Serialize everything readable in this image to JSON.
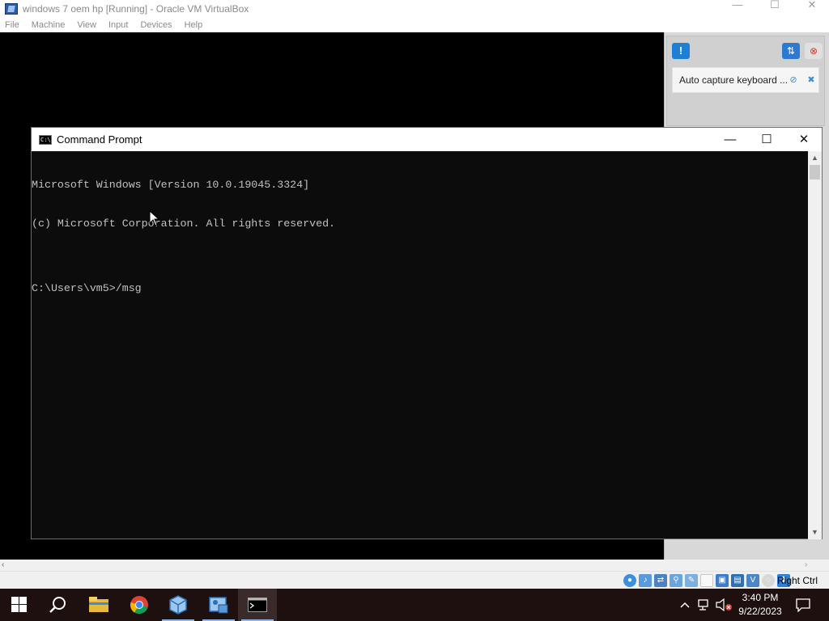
{
  "vbox": {
    "title": "windows 7 oem hp [Running] - Oracle VM VirtualBox",
    "menu": [
      "File",
      "Machine",
      "View",
      "Input",
      "Devices",
      "Help"
    ],
    "window_controls": {
      "minimize": "—",
      "maximize": "☐",
      "close": "✕"
    }
  },
  "side_panel": {
    "notice_text": "Auto capture keyboard ..."
  },
  "cmd": {
    "title": "Command Prompt",
    "icon_text": "C:\\",
    "controls": {
      "minimize": "—",
      "maximize": "☐",
      "close": "✕"
    },
    "lines": [
      "Microsoft Windows [Version 10.0.19045.3324]",
      "(c) Microsoft Corporation. All rights reserved.",
      "",
      "C:\\Users\\vm5>/msg"
    ]
  },
  "statusbar": {
    "host_key": "Right Ctrl"
  },
  "taskbar": {
    "time": "3:40 PM",
    "date": "9/22/2023",
    "apps": [
      "start-icon",
      "search-icon",
      "file-explorer-icon",
      "chrome-icon",
      "virtualbox-icon",
      "vm-settings-icon",
      "command-prompt-icon"
    ]
  },
  "colors": {
    "cmd_bg": "#0c0c0c",
    "cmd_text": "#c0c0c0",
    "taskbar": "#1f1010",
    "accent_blue": "#1e7fd6"
  }
}
